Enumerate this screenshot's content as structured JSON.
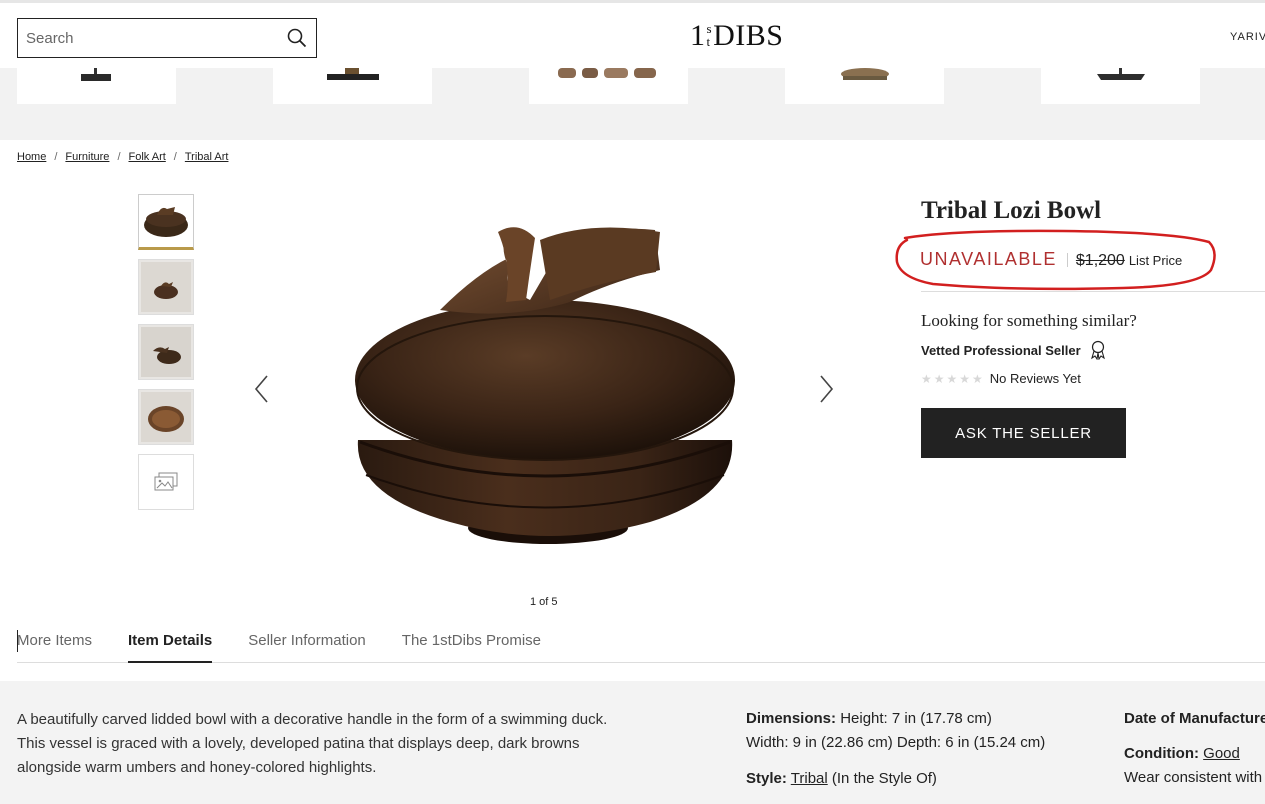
{
  "header": {
    "search_placeholder": "Search",
    "logo_prefix": "1",
    "logo_sup_top": "s",
    "logo_sup_bottom": "t",
    "logo_main": "DIBS",
    "user_name": "YARIV"
  },
  "breadcrumb": {
    "items": [
      "Home",
      "Furniture",
      "Folk Art",
      "Tribal Art"
    ],
    "separator": "/"
  },
  "gallery": {
    "counter": "1 of 5"
  },
  "product": {
    "title": "Tribal Lozi Bowl",
    "status": "UNAVAILABLE",
    "price": "$1,200",
    "price_label": "List Price",
    "similar_prompt": "Looking for something similar?",
    "vetted_label": "Vetted Professional Seller",
    "reviews_label": "No Reviews Yet",
    "ask_button": "ASK THE SELLER"
  },
  "tabs": [
    "More Items",
    "Item Details",
    "Seller Information",
    "The 1stDibs Promise"
  ],
  "details": {
    "description": "A beautifully carved lidded bowl with a decorative handle in the form of a swimming duck. This vessel is graced with a lovely, developed patina that displays deep, dark browns alongside warm umbers and honey-colored highlights.",
    "dimensions_label": "Dimensions:",
    "dimensions_line1": "Height: 7 in (17.78 cm)",
    "dimensions_line2": "Width: 9 in (22.86 cm) Depth: 6 in (15.24 cm)",
    "style_label": "Style:",
    "style_value": "Tribal",
    "style_suffix": "(In the Style Of)",
    "date_label": "Date of Manufacture",
    "condition_label": "Condition:",
    "condition_value": "Good",
    "condition_note": "Wear consistent with"
  },
  "colors": {
    "unavailable": "#b03030",
    "annotation_circle": "#d21f1f",
    "thumb_active": "#b99a4a",
    "button_bg": "#222222"
  }
}
